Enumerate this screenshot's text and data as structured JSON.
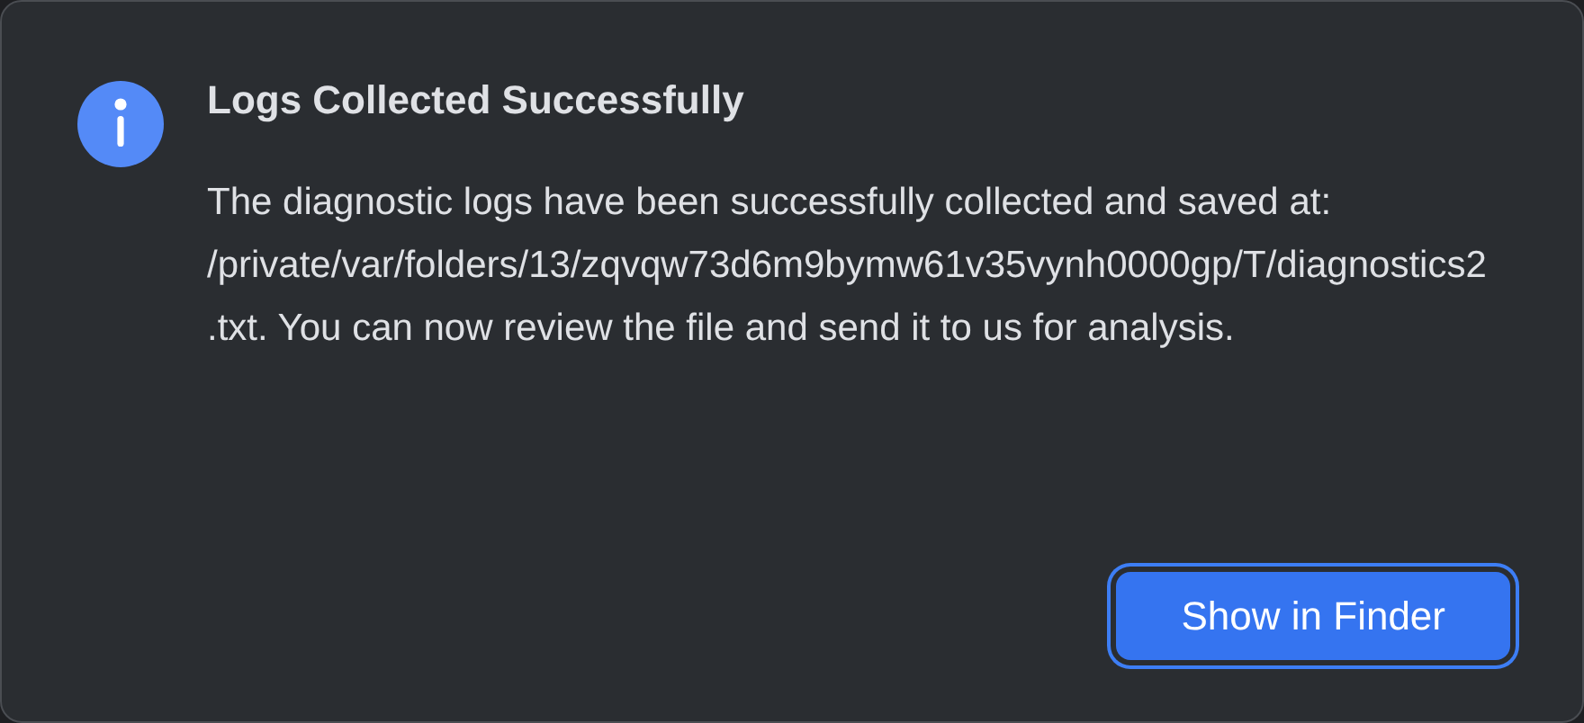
{
  "dialog": {
    "title": "Logs Collected Successfully",
    "message": "The diagnostic logs have been successfully collected and saved at: /private/var/folders/13/zqvqw73d6m9bymw61v35vynh0000gp/T/diagnostics2.txt. You can now review the file and send it to us for analysis.",
    "buttons": [
      {
        "label": "Show in Finder",
        "focused": true
      }
    ]
  }
}
